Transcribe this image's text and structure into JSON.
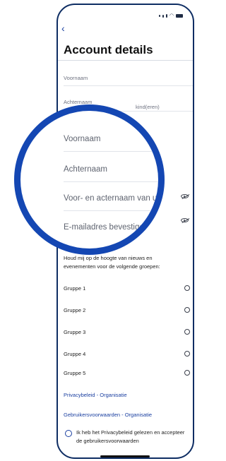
{
  "status_bar": {
    "wifi_glyph": "wifi-icon",
    "battery_glyph": "battery-icon"
  },
  "header": {
    "back_glyph": "‹",
    "title": "Account details"
  },
  "form": {
    "first_name_placeholder": "Voornaam",
    "last_name_placeholder": "Achternaam",
    "child_name_partial": "kind(eren)",
    "child_name_placeholder": "Voor- en acternaam van uw",
    "confirm_email_placeholder": "E-mailadres bevestigen"
  },
  "notifications": {
    "intro": "Houd mij op de hoogte van nieuws en evenementen voor de volgende groepen:",
    "groups": [
      {
        "label": "Gruppe 1"
      },
      {
        "label": "Gruppe 2"
      },
      {
        "label": "Gruppe 3"
      },
      {
        "label": "Gruppe 4"
      },
      {
        "label": "Gruppe 5"
      }
    ]
  },
  "links": {
    "privacy": "Privacybeleid - Organisatie",
    "terms": "Gebruikersvoorwaarden - Organisatie"
  },
  "consent": {
    "text": "Ik heb het Privacybeleid gelezen en accepteer de gebruikersvoorwaarden"
  },
  "colors": {
    "accent": "#1a3fa0",
    "magnifier_ring": "#1447b3",
    "frame": "#0e2d63"
  }
}
